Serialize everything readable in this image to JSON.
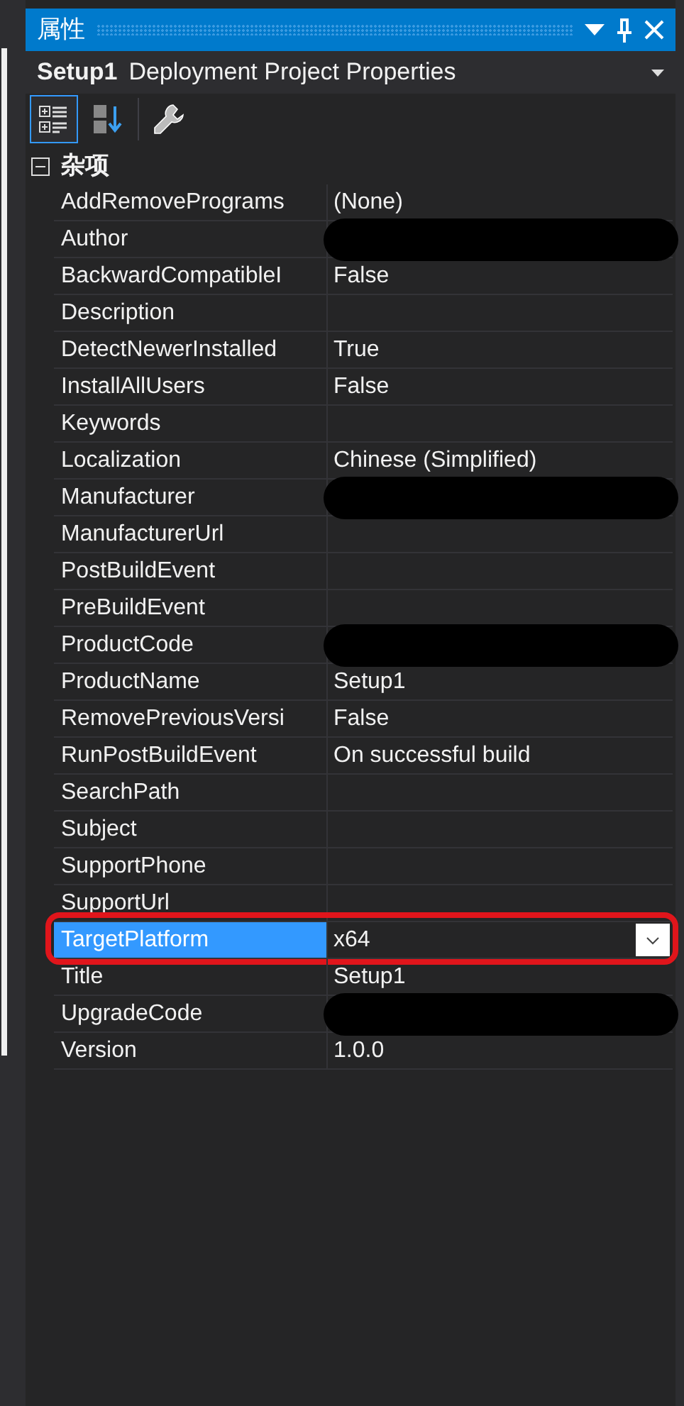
{
  "window": {
    "title": "属性"
  },
  "object_selector": {
    "name": "Setup1",
    "type": "Deployment Project Properties"
  },
  "toolbar": [
    {
      "kind": "categorized",
      "selected": true
    },
    {
      "kind": "alphabetical",
      "selected": false
    },
    {
      "kind": "property-pages",
      "selected": false
    }
  ],
  "category": {
    "label": "杂项",
    "expanded": true
  },
  "properties": [
    {
      "name": "AddRemovePrograms",
      "value": "(None)",
      "selected": false,
      "redacted": false
    },
    {
      "name": "Author",
      "selected": false,
      "redacted": true
    },
    {
      "name": "BackwardCompatibleI",
      "value": "False",
      "selected": false,
      "redacted": false
    },
    {
      "name": "Description",
      "selected": false,
      "redacted": false
    },
    {
      "name": "DetectNewerInstalled",
      "value": "True",
      "selected": false,
      "redacted": false
    },
    {
      "name": "InstallAllUsers",
      "value": "False",
      "selected": false,
      "redacted": false
    },
    {
      "name": "Keywords",
      "selected": false,
      "redacted": false
    },
    {
      "name": "Localization",
      "value": "Chinese (Simplified)",
      "selected": false,
      "redacted": false
    },
    {
      "name": "Manufacturer",
      "selected": false,
      "redacted": true
    },
    {
      "name": "ManufacturerUrl",
      "selected": false,
      "redacted": false
    },
    {
      "name": "PostBuildEvent",
      "selected": false,
      "redacted": false
    },
    {
      "name": "PreBuildEvent",
      "selected": false,
      "redacted": false
    },
    {
      "name": "ProductCode",
      "selected": false,
      "redacted": true
    },
    {
      "name": "ProductName",
      "value": "Setup1",
      "selected": false,
      "redacted": false
    },
    {
      "name": "RemovePreviousVersi",
      "value": "False",
      "selected": false,
      "redacted": false
    },
    {
      "name": "RunPostBuildEvent",
      "value": "On successful build",
      "selected": false,
      "redacted": false
    },
    {
      "name": "SearchPath",
      "selected": false,
      "redacted": false
    },
    {
      "name": "Subject",
      "selected": false,
      "redacted": false
    },
    {
      "name": "SupportPhone",
      "selected": false,
      "redacted": false
    },
    {
      "name": "SupportUrl",
      "selected": false,
      "redacted": false
    },
    {
      "name": "TargetPlatform",
      "value": "x64",
      "selected": true,
      "redacted": false,
      "annotated": true
    },
    {
      "name": "Title",
      "value": "Setup1",
      "selected": false,
      "redacted": false
    },
    {
      "name": "UpgradeCode",
      "selected": false,
      "redacted": true
    },
    {
      "name": "Version",
      "value": "1.0.0",
      "selected": false,
      "redacted": false
    }
  ]
}
